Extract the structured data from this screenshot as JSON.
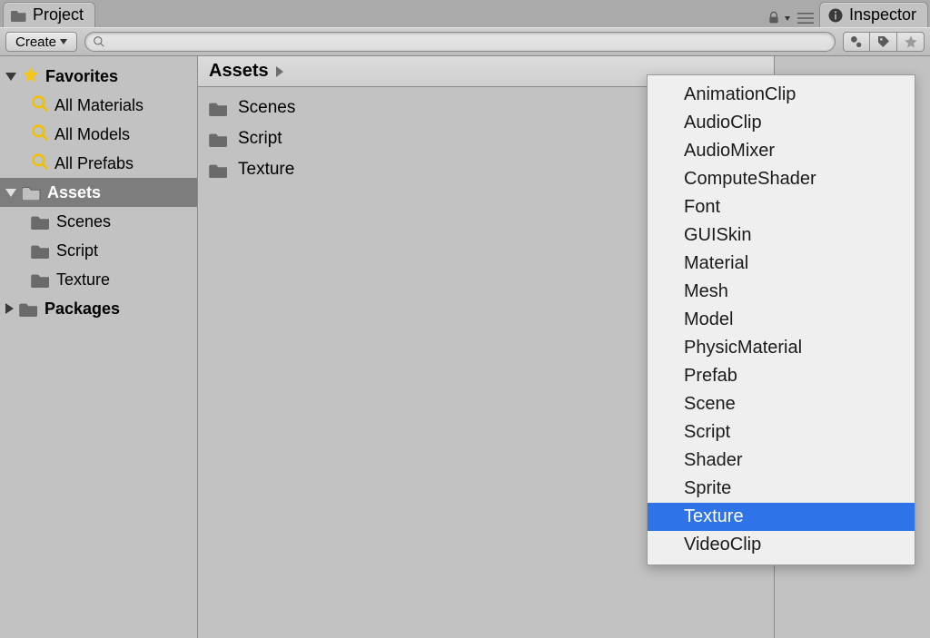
{
  "tabs": {
    "project": "Project",
    "inspector": "Inspector"
  },
  "toolbar": {
    "create": "Create",
    "search_placeholder": ""
  },
  "sidebar": {
    "favorites_label": "Favorites",
    "favorites": [
      "All Materials",
      "All Models",
      "All Prefabs"
    ],
    "assets_label": "Assets",
    "assets": [
      "Scenes",
      "Script",
      "Texture"
    ],
    "packages_label": "Packages"
  },
  "breadcrumb": "Assets",
  "content_folders": [
    "Scenes",
    "Script",
    "Texture"
  ],
  "dropdown": {
    "items": [
      "AnimationClip",
      "AudioClip",
      "AudioMixer",
      "ComputeShader",
      "Font",
      "GUISkin",
      "Material",
      "Mesh",
      "Model",
      "PhysicMaterial",
      "Prefab",
      "Scene",
      "Script",
      "Shader",
      "Sprite",
      "Texture",
      "VideoClip"
    ],
    "selected": "Texture"
  }
}
